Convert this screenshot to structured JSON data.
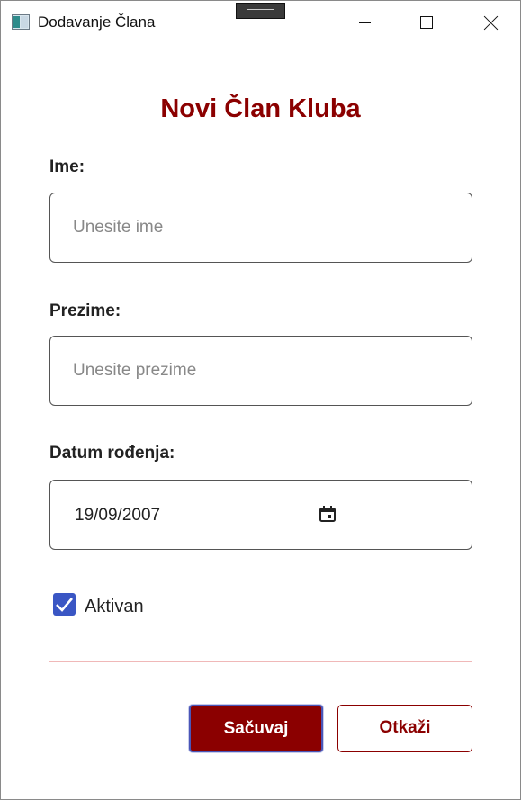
{
  "window": {
    "title": "Dodavanje Člana"
  },
  "form": {
    "heading": "Novi Član Kluba",
    "first_name": {
      "label": "Ime:",
      "value": "",
      "placeholder": "Unesite ime"
    },
    "last_name": {
      "label": "Prezime:",
      "value": "",
      "placeholder": "Unesite prezime"
    },
    "birth_date": {
      "label": "Datum rođenja:",
      "value": "19/09/2007",
      "icon": "calendar-icon"
    },
    "active": {
      "label": "Aktivan",
      "checked": true
    }
  },
  "actions": {
    "save_label": "Sačuvaj",
    "cancel_label": "Otkaži"
  },
  "colors": {
    "accent": "#8b0000",
    "checkbox": "#3a56c4",
    "divider": "#f0b8b8"
  }
}
